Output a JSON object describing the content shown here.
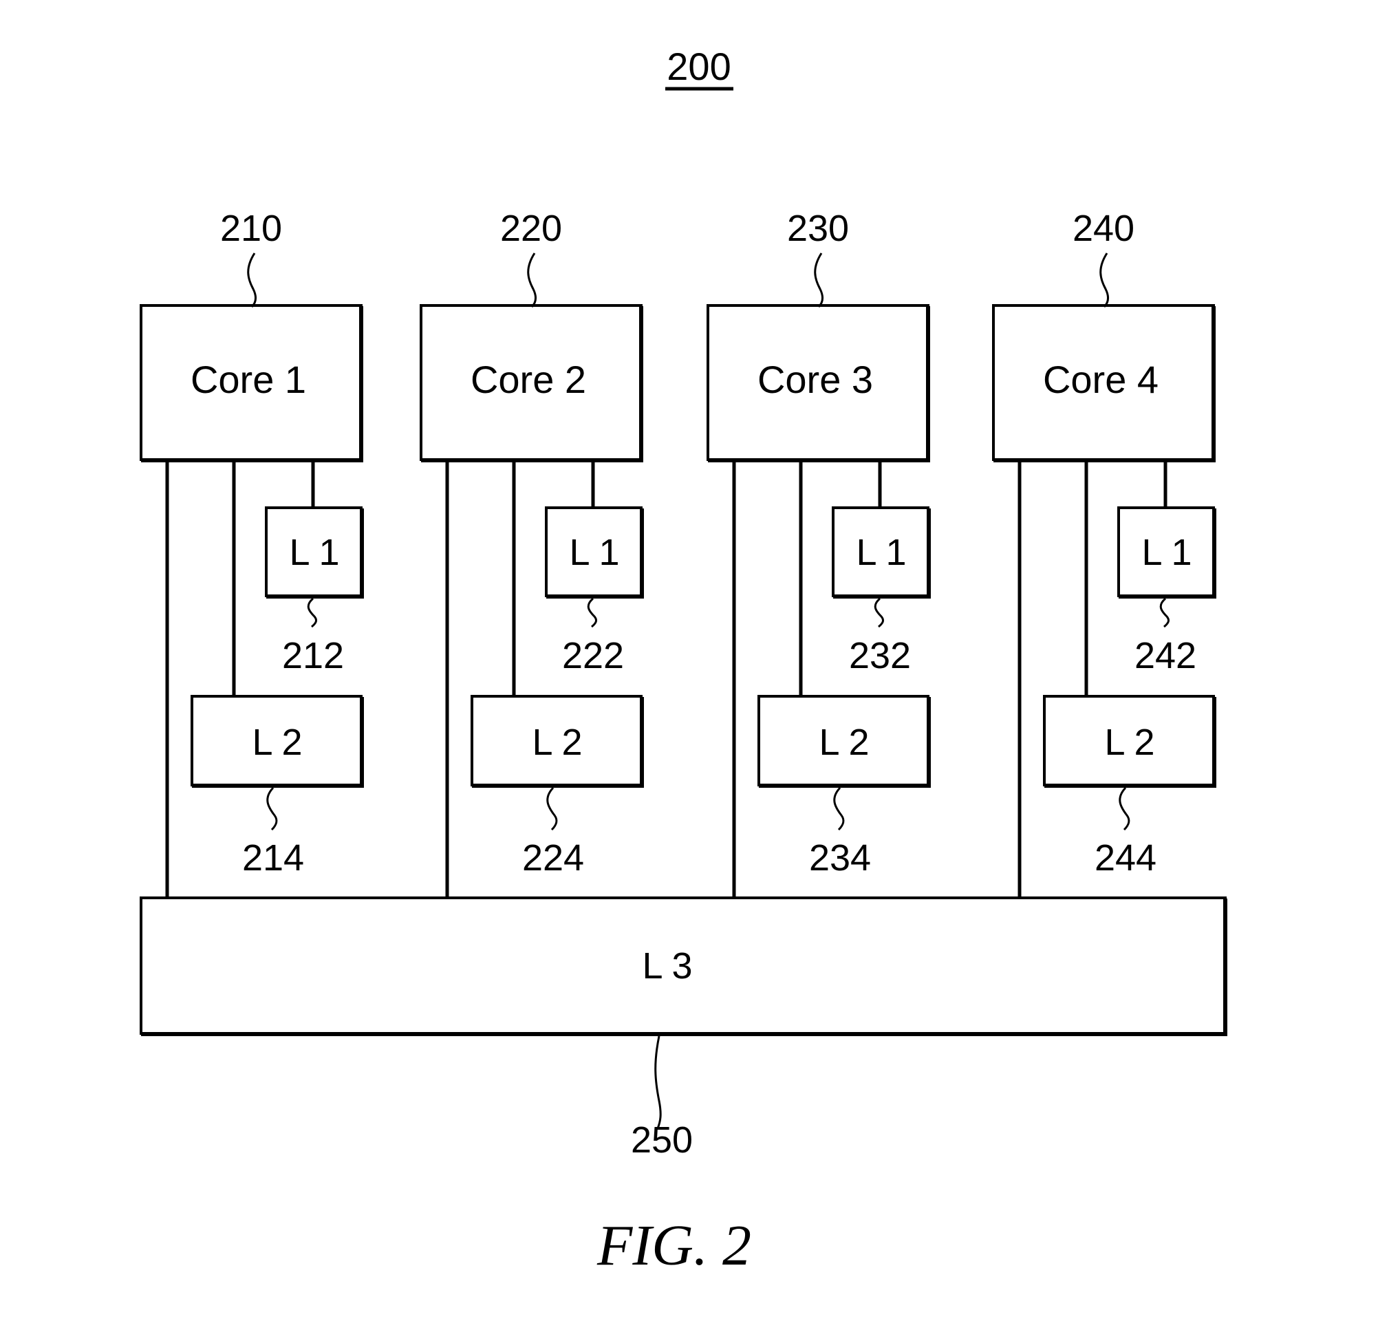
{
  "figure": {
    "ref": "200",
    "caption": "FIG. 2"
  },
  "cores": [
    {
      "label": "Core 1",
      "ref": "210",
      "l1": {
        "label": "L 1",
        "ref": "212"
      },
      "l2": {
        "label": "L 2",
        "ref": "214"
      }
    },
    {
      "label": "Core 2",
      "ref": "220",
      "l1": {
        "label": "L 1",
        "ref": "222"
      },
      "l2": {
        "label": "L 2",
        "ref": "224"
      }
    },
    {
      "label": "Core 3",
      "ref": "230",
      "l1": {
        "label": "L 1",
        "ref": "232"
      },
      "l2": {
        "label": "L 2",
        "ref": "234"
      }
    },
    {
      "label": "Core 4",
      "ref": "240",
      "l1": {
        "label": "L 1",
        "ref": "242"
      },
      "l2": {
        "label": "L 2",
        "ref": "244"
      }
    }
  ],
  "shared_cache": {
    "label": "L 3",
    "ref": "250"
  },
  "connections": [
    {
      "from": "Core 1",
      "to": "L 1 (212)"
    },
    {
      "from": "Core 1",
      "to": "L 2 (214)"
    },
    {
      "from": "Core 1",
      "to": "L 3 (250)"
    },
    {
      "from": "Core 2",
      "to": "L 1 (222)"
    },
    {
      "from": "Core 2",
      "to": "L 2 (224)"
    },
    {
      "from": "Core 2",
      "to": "L 3 (250)"
    },
    {
      "from": "Core 3",
      "to": "L 1 (232)"
    },
    {
      "from": "Core 3",
      "to": "L 2 (234)"
    },
    {
      "from": "Core 3",
      "to": "L 3 (250)"
    },
    {
      "from": "Core 4",
      "to": "L 1 (242)"
    },
    {
      "from": "Core 4",
      "to": "L 2 (244)"
    },
    {
      "from": "Core 4",
      "to": "L 3 (250)"
    }
  ]
}
